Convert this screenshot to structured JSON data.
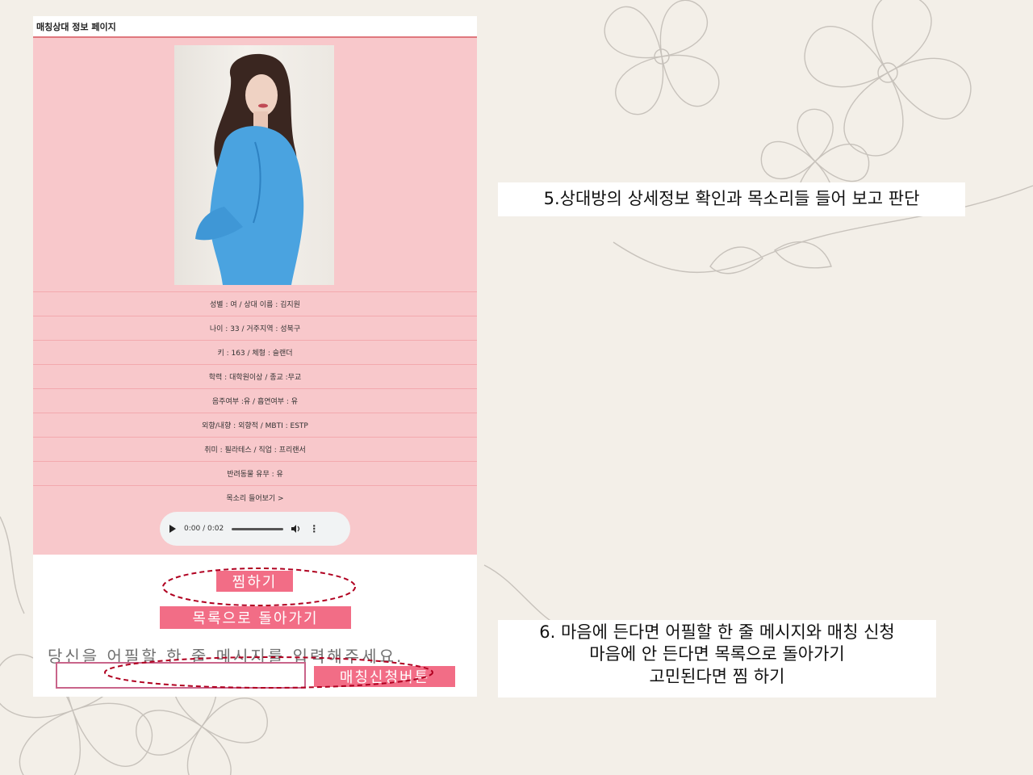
{
  "header": {
    "title": "매칭상대 정보 페이지"
  },
  "profile": {
    "rows": [
      "성별 : 여 / 상대 이름 : 김지원",
      "나이 : 33 / 거주지역 : 성북구",
      "키 : 163  / 체형 : 슬랜더",
      "학력 : 대학원이상  / 종교 :무교",
      "음주여부 :유 / 흡연여부 : 유",
      "외향/내향 : 외향적 / MBTI : ESTP",
      "취미 : 필라테스  / 직업 : 프리랜서",
      "반려동물 유무 : 유",
      "목소리 들어보기 >"
    ],
    "audio": {
      "time": "0:00 / 0:02"
    }
  },
  "actions": {
    "favorite_label": "찜하기",
    "back_label": "목록으로 돌아가기",
    "prompt": "당신을 어필할 한 줄 메시지를 입력해주세요.",
    "input_value": "",
    "submit_label": "매칭신청버튼"
  },
  "notes": {
    "step5": "5.상대방의 상세정보 확인과 목소리들 들어 보고 판단",
    "step6_lines": [
      "6. 마음에 든다면 어필할 한 줄 메시지와 매칭 신청",
      "마음에 안 든다면 목록으로 돌아가기",
      "고민된다면 찜 하기"
    ]
  },
  "colors": {
    "profile_bg": "#f8c8cb",
    "button": "#f26d86",
    "annotation_ellipse": "#b00020"
  }
}
